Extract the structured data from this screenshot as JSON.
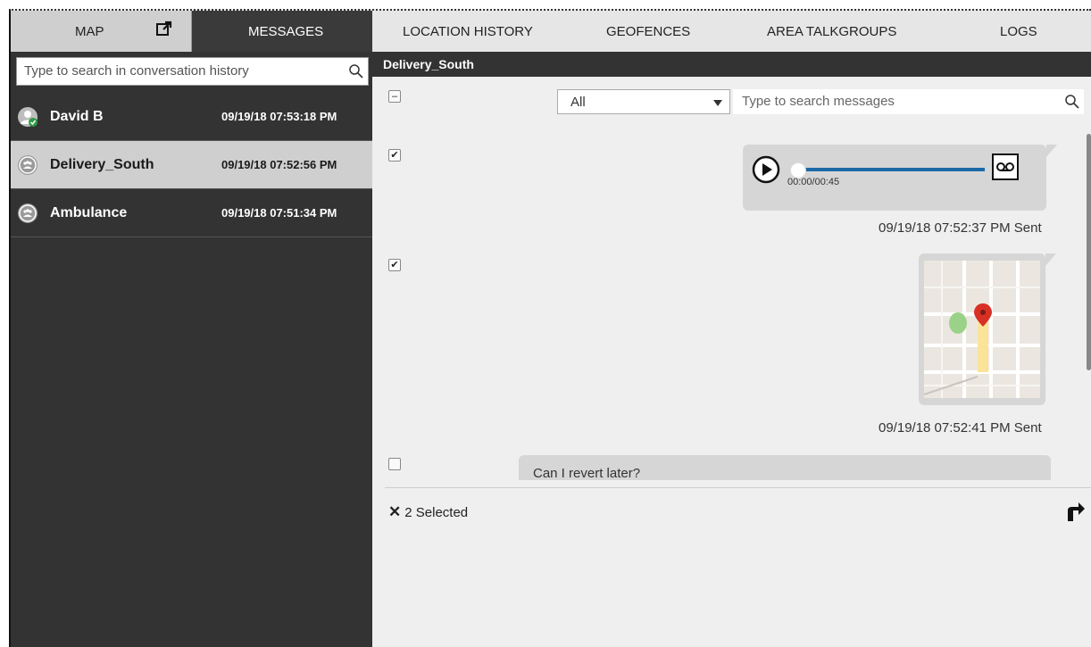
{
  "tabs": {
    "map": "MAP",
    "messages": "MESSAGES",
    "location_history": "LOCATION HISTORY",
    "geofences": "GEOFENCES",
    "area_talkgroups": "AREA TALKGROUPS",
    "logs": "LOGS"
  },
  "conversation_search": {
    "placeholder": "Type to search in conversation history"
  },
  "conversations": [
    {
      "name": "David B",
      "time": "09/19/18 07:53:18 PM"
    },
    {
      "name": "Delivery_South",
      "time": "09/19/18 07:52:56 PM"
    },
    {
      "name": "Ambulance",
      "time": "09/19/18 07:51:34 PM"
    }
  ],
  "conversation_header": "Delivery_South",
  "filter": {
    "selected": "All"
  },
  "message_search": {
    "placeholder": "Type to search messages"
  },
  "messages": [
    {
      "type": "voice",
      "duration": "00:00/00:45",
      "progress": 0,
      "status": "09/19/18 07:52:37 PM Sent"
    },
    {
      "type": "location",
      "status": "09/19/18 07:52:41 PM Sent"
    },
    {
      "type": "text",
      "text": "Can I revert later?"
    }
  ],
  "selection": {
    "count_label": "2 Selected"
  },
  "colors": {
    "dark_panel": "#333333",
    "progress": "#1b6aa6",
    "pin": "#d93025"
  }
}
